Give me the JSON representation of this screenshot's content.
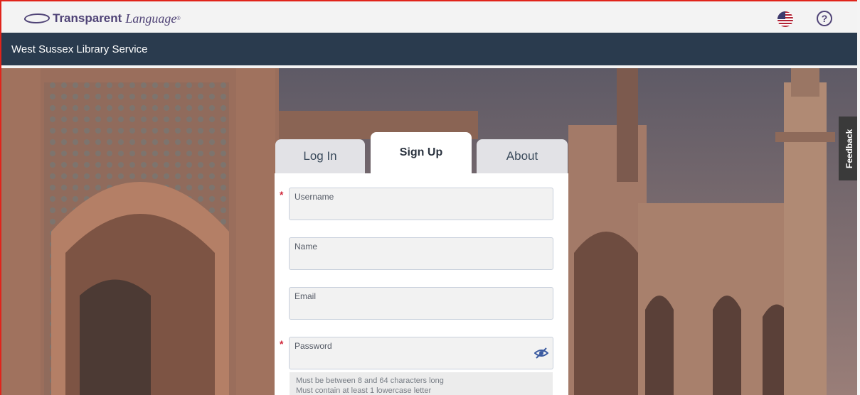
{
  "header": {
    "brand_bold": "Transparent",
    "brand_italic": "Language",
    "brand_reg": "®",
    "language_icon": "us-flag-icon",
    "help_label": "?"
  },
  "subheader": {
    "title": "West Sussex Library Service"
  },
  "feedback": {
    "label": "Feedback"
  },
  "tabs": {
    "login": "Log In",
    "signup": "Sign Up",
    "about": "About",
    "active": "signup"
  },
  "form": {
    "required_mark": "*",
    "fields": [
      {
        "label": "Username",
        "value": "",
        "required": true
      },
      {
        "label": "Name",
        "value": "",
        "required": false
      },
      {
        "label": "Email",
        "value": "",
        "required": false
      },
      {
        "label": "Password",
        "value": "",
        "required": true
      }
    ],
    "password_toggle_icon": "eye-slash-icon",
    "password_hints": [
      "Must be between 8 and 64 characters long",
      "Must contain at least 1 lowercase letter"
    ]
  },
  "colors": {
    "brand_purple": "#4f4376",
    "subheader_bg": "#2a3b4e",
    "required_red": "#d0283b",
    "frame_red": "#e0241b"
  }
}
